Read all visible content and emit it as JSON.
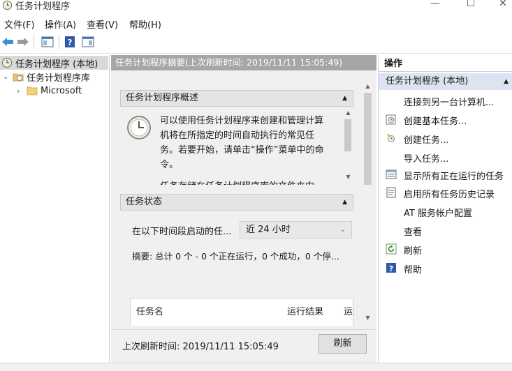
{
  "window": {
    "title": "任务计划程序"
  },
  "menu": [
    "文件(F)",
    "操作(A)",
    "查看(V)",
    "帮助(H)"
  ],
  "tree": {
    "root": "任务计划程序 (本地)",
    "library": "任务计划程序库",
    "child": "Microsoft"
  },
  "center": {
    "header": "任务计划程序摘要(上次刷新时间: 2019/11/11 15:05:49)",
    "overview_title": "任务计划程序概述",
    "overview_text": "可以使用任务计划程序来创建和管理计算机将在所指定的时间自动执行的常见任务。若要开始，请单击“操作”菜单中的命令。",
    "overview_text2": "任务存储在任务计划程序库的文件夹中",
    "status_title": "任务状态",
    "status_label": "在以下时间段启动的任...",
    "status_select": "近 24 小时",
    "summary": "摘要: 总计 0 个 - 0 个正在运行，0 个成功，0 个停...",
    "table_cols": [
      "任务名",
      "运行结果",
      "运"
    ],
    "last_refresh": "上次刷新时间: 2019/11/11 15:05:49",
    "refresh_button": "刷新"
  },
  "actions": {
    "title": "操作",
    "group": "任务计划程序 (本地)",
    "items": [
      {
        "label": "连接到另一台计算机...",
        "icon": "none"
      },
      {
        "label": "创建基本任务...",
        "icon": "basic-task-icon"
      },
      {
        "label": "创建任务...",
        "icon": "create-task-icon"
      },
      {
        "label": "导入任务...",
        "icon": "none"
      },
      {
        "label": "显示所有正在运行的任务",
        "icon": "running-tasks-icon"
      },
      {
        "label": "启用所有任务历史记录",
        "icon": "history-icon"
      },
      {
        "label": "AT 服务帐户配置",
        "icon": "none"
      },
      {
        "label": "查看",
        "icon": "none"
      },
      {
        "label": "刷新",
        "icon": "refresh-icon"
      },
      {
        "label": "帮助",
        "icon": "help-icon"
      }
    ]
  },
  "colors": {
    "header_bg": "#a6a6a6",
    "group_bg": "#dbe4f0",
    "selected_bg": "#d9d9d9"
  }
}
